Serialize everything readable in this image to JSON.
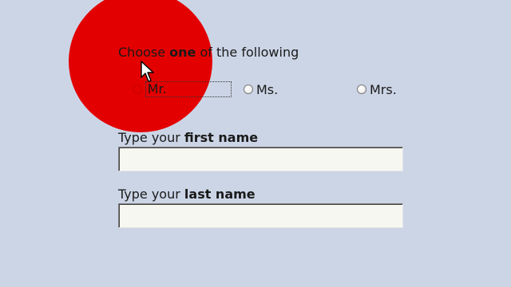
{
  "question": {
    "prefix": "Choose ",
    "emphasis": "one",
    "suffix": " of the following"
  },
  "title_options": [
    {
      "label": "Mr.",
      "selected": true
    },
    {
      "label": "Ms.",
      "selected": false
    },
    {
      "label": "Mrs.",
      "selected": false
    }
  ],
  "first_name": {
    "label_prefix": "Type your ",
    "label_emphasis": "first name",
    "value": ""
  },
  "last_name": {
    "label_prefix": "Type your ",
    "label_emphasis": "last name",
    "value": ""
  },
  "colors": {
    "background": "#ccd5e6",
    "highlight_circle": "#e30000",
    "selected_radio": "#e00000"
  },
  "icons": {
    "cursor": "mouse-pointer-icon"
  }
}
